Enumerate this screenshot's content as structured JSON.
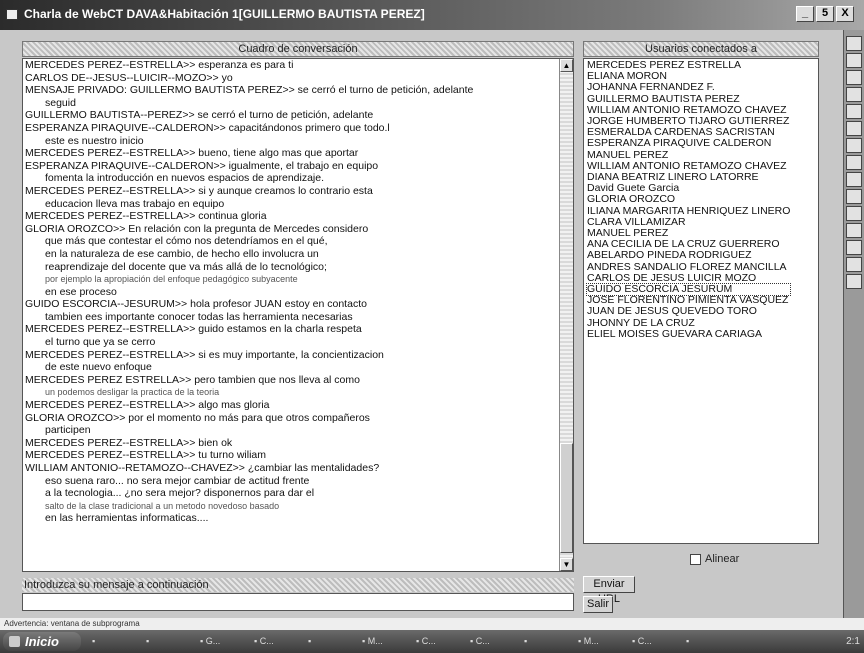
{
  "window": {
    "title": "Charla de WebCT   DAVA&Habitación 1[GUILLERMO BAUTISTA PEREZ]",
    "minimize": "_",
    "restore": "5",
    "close": "X"
  },
  "chat": {
    "header": "Cuadro de conversación",
    "lines": [
      {
        "t": "MERCEDES PEREZ--ESTRELLA>> esperanza es para ti",
        "ind": false
      },
      {
        "t": "CARLOS DE--JESUS--LUICIR--MOZO>> yo",
        "ind": false
      },
      {
        "t": "MENSAJE PRIVADO: GUILLERMO BAUTISTA PEREZ>> se cerró el turno de petición, adelante",
        "ind": false
      },
      {
        "t": "seguid",
        "ind": true
      },
      {
        "t": "GUILLERMO BAUTISTA--PEREZ>> se cerró el turno de petición, adelante",
        "ind": false
      },
      {
        "t": "ESPERANZA PIRAQUIVE--CALDERON>> capacitándonos primero que todo.l",
        "ind": false
      },
      {
        "t": "este es nuestro inicio",
        "ind": true
      },
      {
        "t": "MERCEDES PEREZ--ESTRELLA>> bueno, tiene algo mas que aportar",
        "ind": false
      },
      {
        "t": "ESPERANZA PIRAQUIVE--CALDERON>> igualmente, el trabajo en equipo",
        "ind": false
      },
      {
        "t": "fomenta la introducción en nuevos espacios de aprendizaje.",
        "ind": true
      },
      {
        "t": "MERCEDES PEREZ--ESTRELLA>> si y aunque creamos lo contrario esta",
        "ind": false
      },
      {
        "t": "educacion lleva mas trabajo en equipo",
        "ind": true
      },
      {
        "t": "MERCEDES PEREZ--ESTRELLA>> continua gloria",
        "ind": false
      },
      {
        "t": "GLORIA OROZCO>> En relación con la pregunta de Mercedes considero",
        "ind": false
      },
      {
        "t": "que más que contestar el cómo nos detendríamos en el qué,",
        "ind": true
      },
      {
        "t": "en la naturaleza de ese cambio, de hecho ello involucra un",
        "ind": true
      },
      {
        "t": "reaprendizaje del docente que va más allá de lo tecnológico;",
        "ind": true
      },
      {
        "t": "por ejemplo la apropiación del enfoque pedagógico subyacente",
        "ind": true,
        "faint": true
      },
      {
        "t": "en ese proceso",
        "ind": true
      },
      {
        "t": "GUIDO ESCORCIA--JESURUM>> hola profesor JUAN estoy en contacto",
        "ind": false
      },
      {
        "t": "tambien ees importante conocer todas las herramienta necesarias",
        "ind": true
      },
      {
        "t": "MERCEDES PEREZ--ESTRELLA>> guido estamos en la charla respeta",
        "ind": false
      },
      {
        "t": "el turno que ya se cerro",
        "ind": true
      },
      {
        "t": "MERCEDES PEREZ--ESTRELLA>> si es muy importante, la concientizacion",
        "ind": false
      },
      {
        "t": "de este nuevo enfoque",
        "ind": true
      },
      {
        "t": "MERCEDES PEREZ ESTRELLA>> pero tambien que nos lleva al como",
        "ind": false
      },
      {
        "t": "un podemos desligar la practica de la teoria",
        "ind": true,
        "faint": true
      },
      {
        "t": "MERCEDES PEREZ--ESTRELLA>> algo mas gloria",
        "ind": false
      },
      {
        "t": "GLORIA OROZCO>> por el momento no más para que otros compañeros",
        "ind": false
      },
      {
        "t": "participen",
        "ind": true
      },
      {
        "t": "MERCEDES PEREZ--ESTRELLA>> bien ok",
        "ind": false
      },
      {
        "t": "MERCEDES PEREZ--ESTRELLA>> tu turno wiliam",
        "ind": false
      },
      {
        "t": "WILLIAM ANTONIO--RETAMOZO--CHAVEZ>> ¿cambiar las mentalidades?",
        "ind": false
      },
      {
        "t": "eso suena raro... no sera mejor cambiar de actitud frente",
        "ind": true
      },
      {
        "t": "a la tecnologia... ¿no sera mejor? disponernos para dar el",
        "ind": true
      },
      {
        "t": "salto de la clase tradicional a un metodo novedoso basado",
        "ind": true,
        "faint": true
      },
      {
        "t": "en las herramientas informaticas....",
        "ind": true
      }
    ]
  },
  "users": {
    "header": "Usuarios conectados a",
    "list": [
      "MERCEDES PEREZ ESTRELLA",
      "ELIANA MORON",
      "JOHANNA FERNANDEZ F.",
      "GUILLERMO BAUTISTA PEREZ",
      "WILLIAM ANTONIO RETAMOZO CHAVEZ",
      "JORGE HUMBERTO TIJARO GUTIERREZ",
      "ESMERALDA CARDENAS SACRISTAN",
      "ESPERANZA PIRAQUIVE CALDERON",
      "MANUEL PEREZ",
      "WILLIAM ANTONIO RETAMOZO CHAVEZ",
      "DIANA BEATRIZ LINERO LATORRE",
      "David Guete Garcia",
      "GLORIA OROZCO",
      "ILIANA MARGARITA HENRIQUEZ LINERO",
      "CLARA VILLAMIZAR",
      "MANUEL PEREZ",
      "ANA CECILIA DE LA CRUZ GUERRERO",
      "ABELARDO PINEDA RODRIGUEZ",
      "ANDRES SANDALIO FLOREZ MANCILLA",
      "CARLOS DE JESUS LUICIR MOZO",
      "GUIDO ESCORCIA JESURUM",
      "JOSE FLORENTINO PIMIENTA VASQUEZ",
      "JUAN DE JESUS QUEVEDO TORO",
      "JHONNY DE LA CRUZ",
      "ELIEL MOISES GUEVARA CARIAGA"
    ],
    "selected_index": 20
  },
  "options": {
    "checkbox_label": "Alinear"
  },
  "input": {
    "label": "Introduzca su mensaje a continuación",
    "value": ""
  },
  "buttons": {
    "send_url": "Enviar URL",
    "exit": "Salir"
  },
  "status": {
    "text": "Advertencia: ventana de subprograma"
  },
  "taskbar": {
    "start": "Inicio",
    "tasks": [
      "",
      "",
      "G...",
      "C...",
      "",
      "M...",
      "C...",
      "C...",
      "",
      "M...",
      "C...",
      ""
    ],
    "tray": "2:1"
  },
  "scroll": {
    "chat_position": 0.88,
    "right_strip_buttons": [
      "1",
      "2",
      "3",
      "4",
      "5",
      "6",
      "7",
      "8",
      "9",
      "10",
      "11",
      "12",
      "13",
      "14",
      "15"
    ]
  }
}
